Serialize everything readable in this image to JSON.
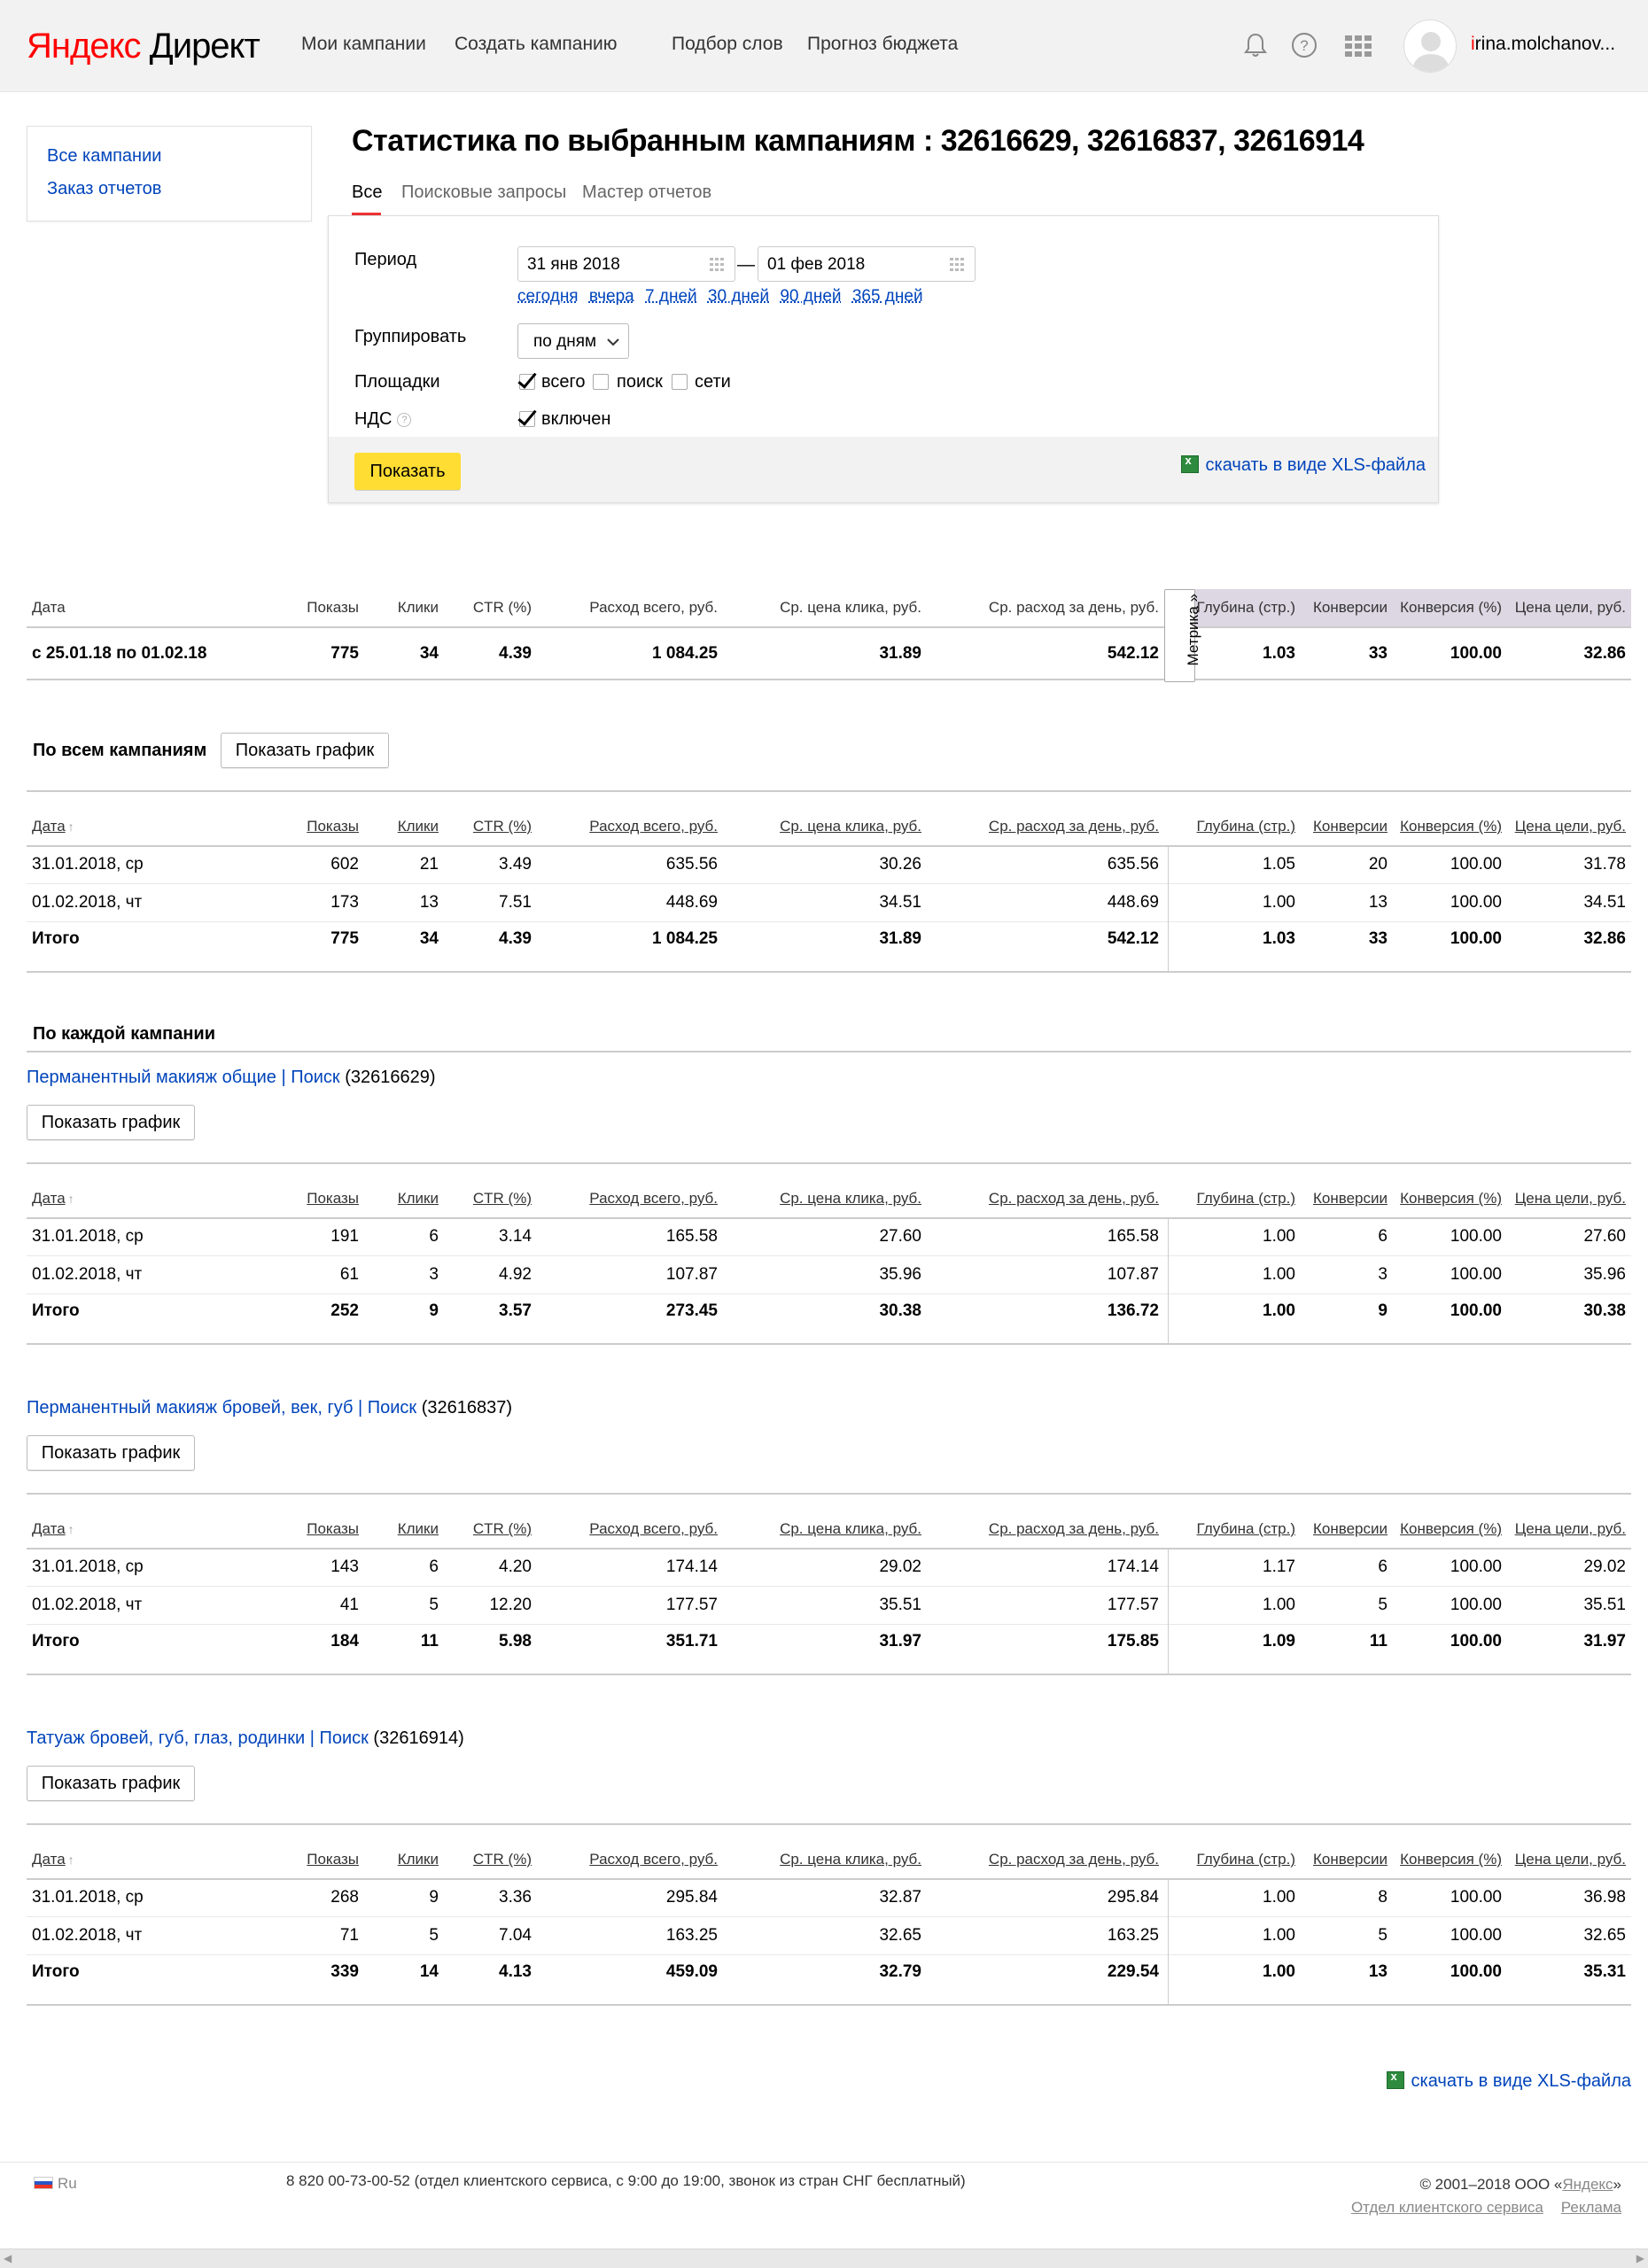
{
  "header": {
    "logo_ya": "Яндекс",
    "logo_rest": " Директ",
    "nav": [
      "Мои кампании",
      "Создать кампанию",
      "Подбор слов",
      "Прогноз бюджета"
    ],
    "user_first": "i",
    "user_rest": "rina.molchanov..."
  },
  "sidebar": {
    "items": [
      "Все кампании",
      "Заказ отчетов"
    ]
  },
  "page": {
    "title": "Статистика по выбранным кампаниям : 32616629, 32616837, 32616914",
    "tabs": [
      "Все",
      "Поисковые запросы",
      "Мастер отчетов"
    ]
  },
  "filters": {
    "period_label": "Период",
    "date_from": "31 янв 2018",
    "date_to": "01 фев 2018",
    "period_links": [
      "сегодня",
      "вчера",
      "7 дней",
      "30 дней",
      "90 дней",
      "365 дней"
    ],
    "group_label": "Группировать",
    "group_value": "по дням",
    "platforms_label": "Площадки",
    "platforms": [
      {
        "label": "всего",
        "checked": true
      },
      {
        "label": "поиск",
        "checked": false
      },
      {
        "label": "сети",
        "checked": false
      }
    ],
    "vat_label": "НДС",
    "vat_help": "?",
    "vat_option": "включен",
    "vat_checked": true,
    "show_button": "Показать",
    "xls_link": "скачать в виде XLS-файла"
  },
  "columns": [
    "Дата",
    "Показы",
    "Клики",
    "CTR (%)",
    "Расход всего, руб.",
    "Ср. цена клика, руб.",
    "Ср. расход за день, руб.",
    "Глубина (стр.)",
    "Конверсии",
    "Конверсия (%)",
    "Цена цели, руб."
  ],
  "sort_marker": "↑",
  "metrika_label": "Метрика »",
  "summary": {
    "row": [
      "с 25.01.18 по 01.02.18",
      "775",
      "34",
      "4.39",
      "1 084.25",
      "31.89",
      "542.12",
      "1.03",
      "33",
      "100.00",
      "32.86"
    ]
  },
  "all_campaigns": {
    "title": "По всем кампаниям",
    "chart_button": "Показать график",
    "rows": [
      [
        "31.01.2018, ср",
        "602",
        "21",
        "3.49",
        "635.56",
        "30.26",
        "635.56",
        "1.05",
        "20",
        "100.00",
        "31.78"
      ],
      [
        "01.02.2018, чт",
        "173",
        "13",
        "7.51",
        "448.69",
        "34.51",
        "448.69",
        "1.00",
        "13",
        "100.00",
        "34.51"
      ]
    ],
    "total": [
      "Итого",
      "775",
      "34",
      "4.39",
      "1 084.25",
      "31.89",
      "542.12",
      "1.03",
      "33",
      "100.00",
      "32.86"
    ]
  },
  "per_campaign_title": "По каждой кампании",
  "campaigns": [
    {
      "name": "Перманентный макияж общие | Поиск",
      "id": " (32616629)",
      "chart_button": "Показать график",
      "rows": [
        [
          "31.01.2018, ср",
          "191",
          "6",
          "3.14",
          "165.58",
          "27.60",
          "165.58",
          "1.00",
          "6",
          "100.00",
          "27.60"
        ],
        [
          "01.02.2018, чт",
          "61",
          "3",
          "4.92",
          "107.87",
          "35.96",
          "107.87",
          "1.00",
          "3",
          "100.00",
          "35.96"
        ]
      ],
      "total": [
        "Итого",
        "252",
        "9",
        "3.57",
        "273.45",
        "30.38",
        "136.72",
        "1.00",
        "9",
        "100.00",
        "30.38"
      ]
    },
    {
      "name": "Перманентный макияж бровей, век, губ | Поиск",
      "id": " (32616837)",
      "chart_button": "Показать график",
      "rows": [
        [
          "31.01.2018, ср",
          "143",
          "6",
          "4.20",
          "174.14",
          "29.02",
          "174.14",
          "1.17",
          "6",
          "100.00",
          "29.02"
        ],
        [
          "01.02.2018, чт",
          "41",
          "5",
          "12.20",
          "177.57",
          "35.51",
          "177.57",
          "1.00",
          "5",
          "100.00",
          "35.51"
        ]
      ],
      "total": [
        "Итого",
        "184",
        "11",
        "5.98",
        "351.71",
        "31.97",
        "175.85",
        "1.09",
        "11",
        "100.00",
        "31.97"
      ]
    },
    {
      "name": "Татуаж бровей, губ, глаз, родинки | Поиск",
      "id": " (32616914)",
      "chart_button": "Показать график",
      "rows": [
        [
          "31.01.2018, ср",
          "268",
          "9",
          "3.36",
          "295.84",
          "32.87",
          "295.84",
          "1.00",
          "8",
          "100.00",
          "36.98"
        ],
        [
          "01.02.2018, чт",
          "71",
          "5",
          "7.04",
          "163.25",
          "32.65",
          "163.25",
          "1.00",
          "5",
          "100.00",
          "32.65"
        ]
      ],
      "total": [
        "Итого",
        "339",
        "14",
        "4.13",
        "459.09",
        "32.79",
        "229.54",
        "1.00",
        "13",
        "100.00",
        "35.31"
      ]
    }
  ],
  "bottom_xls_link": "скачать в виде XLS-файла",
  "footer": {
    "lang": "Ru",
    "phone": "8 820 00-73-00-52 (отдел клиентского сервиса, с 9:00 до 19:00, звонок из стран СНГ бесплатный)",
    "copyright_prefix": "© 2001–2018 ООО «",
    "copyright_link": "Яндекс",
    "copyright_suffix": "»",
    "links": [
      "Отдел клиентского сервиса",
      "Реклама"
    ]
  }
}
